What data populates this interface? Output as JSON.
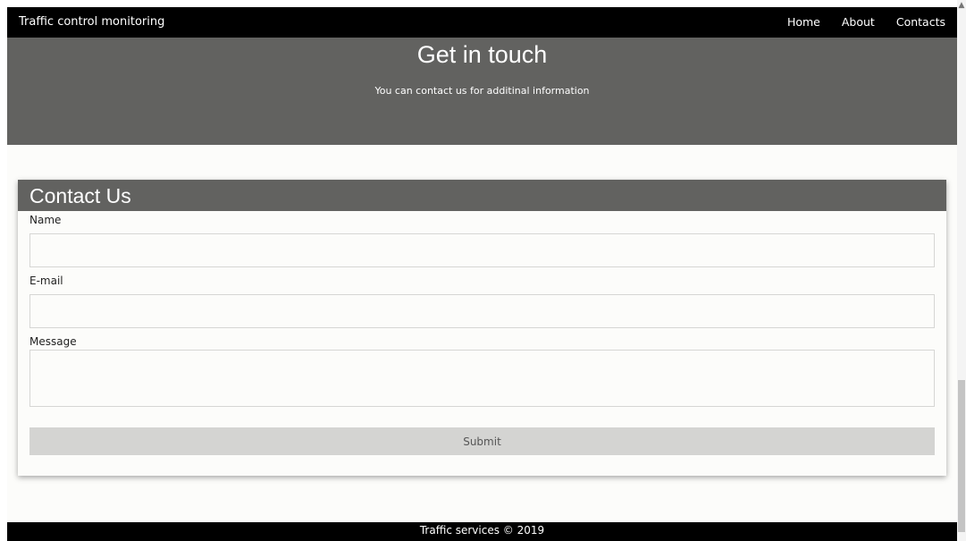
{
  "navbar": {
    "brand": "Traffic control monitoring",
    "links": [
      "Home",
      "About",
      "Contacts"
    ]
  },
  "hero": {
    "title": "Get in touch",
    "subtitle": "You can contact us for additinal information"
  },
  "contact_form": {
    "title": "Contact Us",
    "name_label": "Name",
    "name_value": "",
    "email_label": "E-mail",
    "email_value": "",
    "message_label": "Message",
    "message_value": "",
    "submit_label": "Submit"
  },
  "footer": {
    "text": "Traffic services © 2019"
  },
  "colors": {
    "navbar_bg": "#000000",
    "banner_bg": "#626260",
    "page_bg": "#fcfcfa",
    "button_bg": "#d4d4d2"
  }
}
